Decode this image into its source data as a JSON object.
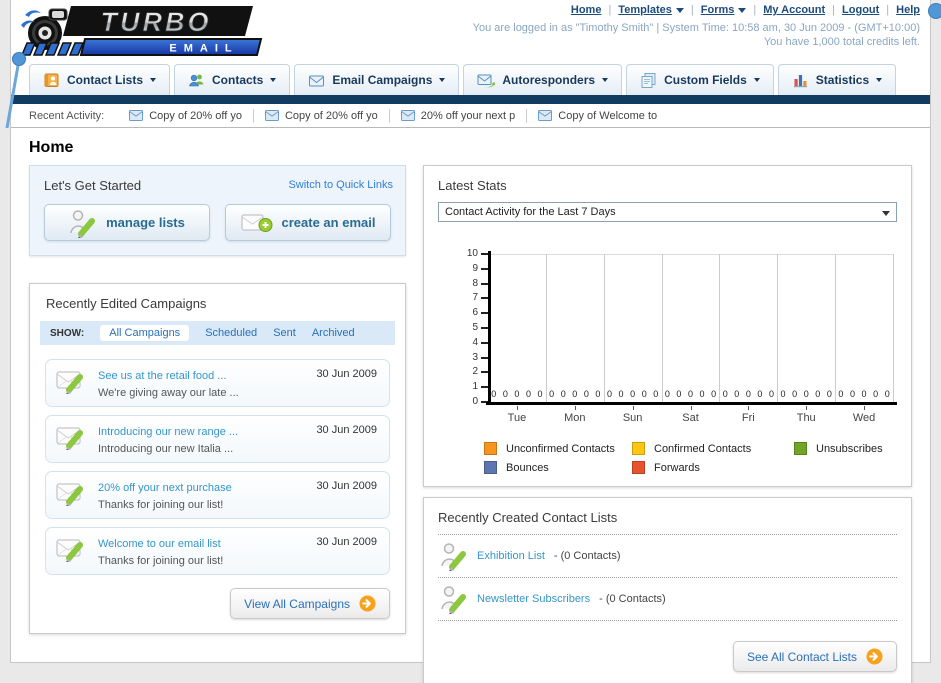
{
  "header": {
    "logo": {
      "line1": "TURBO",
      "line2": "E M A I L"
    },
    "nav_links": [
      {
        "label": "Home",
        "caret": false
      },
      {
        "label": "Templates",
        "caret": true
      },
      {
        "label": "Forms",
        "caret": true
      },
      {
        "label": "My Account",
        "caret": false
      },
      {
        "label": "Logout",
        "caret": false
      },
      {
        "label": "Help",
        "caret": false
      }
    ],
    "login_line1": "You are logged in as \"Timothy Smith\" | System Time: 10:58 am, 30 Jun 2009 - (GMT+10:00)",
    "login_line2": "You have 1,000 total credits left."
  },
  "tabs": [
    {
      "label": "Contact Lists",
      "icon": "contact-lists-icon"
    },
    {
      "label": "Contacts",
      "icon": "contacts-icon"
    },
    {
      "label": "Email Campaigns",
      "icon": "email-campaigns-icon"
    },
    {
      "label": "Autoresponders",
      "icon": "autoresponders-icon"
    },
    {
      "label": "Custom Fields",
      "icon": "custom-fields-icon"
    },
    {
      "label": "Statistics",
      "icon": "statistics-icon"
    }
  ],
  "recent_activity": {
    "label": "Recent Activity:",
    "items": [
      "Copy of 20% off yo",
      "Copy of 20% off yo",
      "20% off your next p",
      "Copy of Welcome to"
    ]
  },
  "page": {
    "title": "Home"
  },
  "get_started": {
    "title": "Let's Get Started",
    "switch_link": "Switch to Quick Links",
    "buttons": [
      {
        "label": "manage lists",
        "icon": "person-edit-icon"
      },
      {
        "label": "create an email",
        "icon": "envelope-add-icon"
      }
    ]
  },
  "campaigns": {
    "title": "Recently Edited Campaigns",
    "show_label": "SHOW:",
    "filters": [
      "All Campaigns",
      "Scheduled",
      "Sent",
      "Archived"
    ],
    "active_filter": "All Campaigns",
    "items": [
      {
        "title": "See us at the retail food ...",
        "subtitle": "We're giving away our late ...",
        "date": "30 Jun 2009"
      },
      {
        "title": "Introducing our new range ...",
        "subtitle": "Introducing our new Italia ...",
        "date": "30 Jun 2009"
      },
      {
        "title": "20% off your next purchase",
        "subtitle": "Thanks for joining our list!",
        "date": "30 Jun 2009"
      },
      {
        "title": "Welcome to our email list",
        "subtitle": "Thanks for joining our list!",
        "date": "30 Jun 2009"
      }
    ],
    "view_all_label": "View All Campaigns"
  },
  "stats": {
    "title": "Latest Stats",
    "dropdown_value": "Contact Activity for the Last 7 Days"
  },
  "chart_data": {
    "type": "bar",
    "title": "Contact Activity for the Last 7 Days",
    "categories": [
      "Tue",
      "Mon",
      "Sun",
      "Sat",
      "Fri",
      "Thu",
      "Wed"
    ],
    "series": [
      {
        "name": "Unconfirmed Contacts",
        "color": "#f7941d",
        "values": [
          0,
          0,
          0,
          0,
          0,
          0,
          0
        ]
      },
      {
        "name": "Confirmed Contacts",
        "color": "#fcc613",
        "values": [
          0,
          0,
          0,
          0,
          0,
          0,
          0
        ]
      },
      {
        "name": "Unsubscribes",
        "color": "#70a525",
        "values": [
          0,
          0,
          0,
          0,
          0,
          0,
          0
        ]
      },
      {
        "name": "Bounces",
        "color": "#5b76b0",
        "values": [
          0,
          0,
          0,
          0,
          0,
          0,
          0
        ]
      },
      {
        "name": "Forwards",
        "color": "#e8532e",
        "values": [
          0,
          0,
          0,
          0,
          0,
          0,
          0
        ]
      }
    ],
    "ylim": [
      0,
      10
    ],
    "yticks": [
      0,
      1,
      2,
      3,
      4,
      5,
      6,
      7,
      8,
      9,
      10
    ],
    "grid": true,
    "legend_position": "bottom"
  },
  "contact_lists": {
    "title": "Recently Created Contact Lists",
    "items": [
      {
        "name": "Exhibition List",
        "count": "- (0 Contacts)"
      },
      {
        "name": "Newsletter Subscribers",
        "count": "- (0 Contacts)"
      }
    ],
    "see_all_label": "See All Contact Lists"
  }
}
